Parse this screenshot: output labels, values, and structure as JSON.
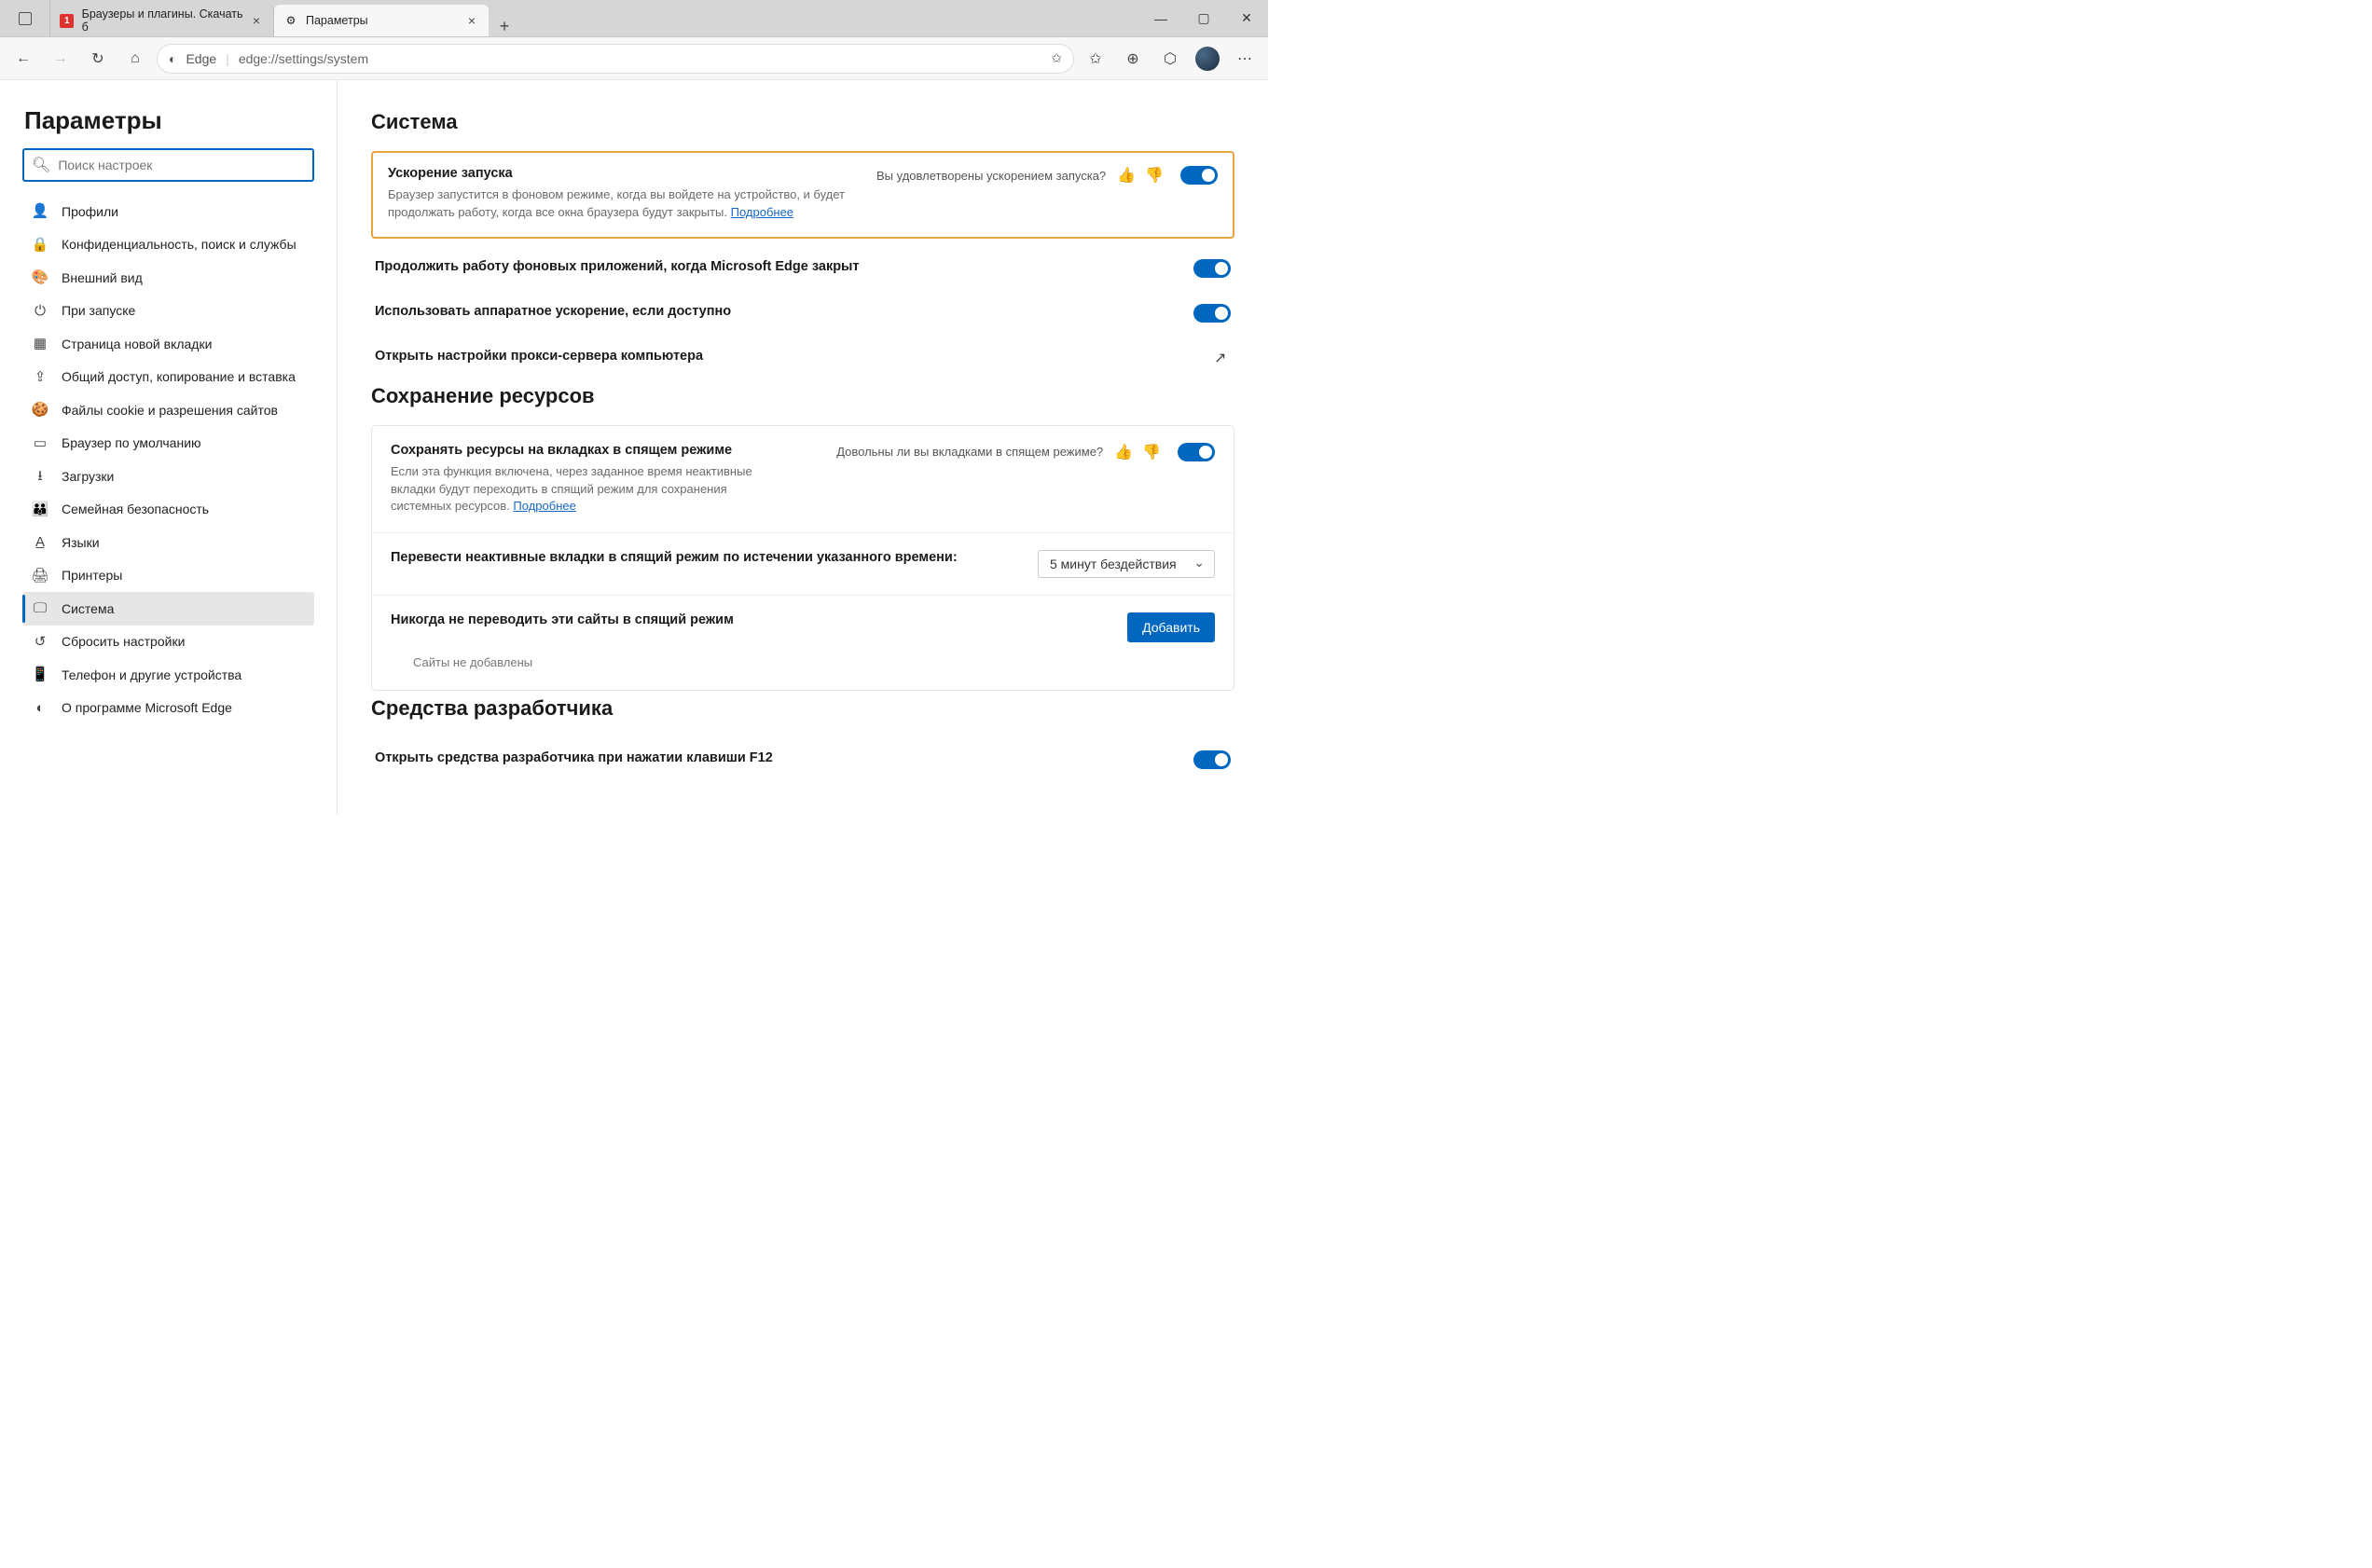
{
  "titlebar": {
    "tabs": [
      {
        "label": "Браузеры и плагины. Скачать б"
      },
      {
        "label": "Параметры"
      }
    ]
  },
  "addr": {
    "brand": "Edge",
    "url": "edge://settings/system"
  },
  "sidebar": {
    "title": "Параметры",
    "search_placeholder": "Поиск настроек",
    "items": [
      {
        "label": "Профили"
      },
      {
        "label": "Конфиденциальность, поиск и службы"
      },
      {
        "label": "Внешний вид"
      },
      {
        "label": "При запуске"
      },
      {
        "label": "Страница новой вкладки"
      },
      {
        "label": "Общий доступ, копирование и вставка"
      },
      {
        "label": "Файлы cookie и разрешения сайтов"
      },
      {
        "label": "Браузер по умолчанию"
      },
      {
        "label": "Загрузки"
      },
      {
        "label": "Семейная безопасность"
      },
      {
        "label": "Языки"
      },
      {
        "label": "Принтеры"
      },
      {
        "label": "Система"
      },
      {
        "label": "Сбросить настройки"
      },
      {
        "label": "Телефон и другие устройства"
      },
      {
        "label": "О программе Microsoft Edge"
      }
    ]
  },
  "system": {
    "section": "Система",
    "startup": {
      "title": "Ускорение запуска",
      "desc_pre": "Браузер запустится в фоновом режиме, когда вы войдете на устройство, и будет продолжать работу, когда все окна браузера будут закрыты. ",
      "link": "Подробнее",
      "feedback": "Вы удовлетворены ускорением запуска?"
    },
    "bg_apps": "Продолжить работу фоновых приложений, когда Microsoft Edge закрыт",
    "hw_accel": "Использовать аппаратное ускорение, если доступно",
    "proxy": "Открыть настройки прокси-сервера компьютера"
  },
  "resources": {
    "section": "Сохранение ресурсов",
    "sleep": {
      "title": "Сохранять ресурсы на вкладках в спящем режиме",
      "desc_pre": "Если эта функция включена, через заданное время неактивные вкладки будут переходить в спящий режим для сохранения системных ресурсов. ",
      "link": "Подробнее",
      "feedback": "Довольны ли вы вкладками в спящем режиме?"
    },
    "timeout_label": "Перевести неактивные вкладки в спящий режим по истечении указанного времени:",
    "timeout_value": "5 минут бездействия",
    "never_label": "Никогда не переводить эти сайты в спящий режим",
    "add_button": "Добавить",
    "empty": "Сайты не добавлены"
  },
  "devtools": {
    "section": "Средства разработчика",
    "f12": "Открыть средства разработчика при нажатии клавиши F12"
  }
}
